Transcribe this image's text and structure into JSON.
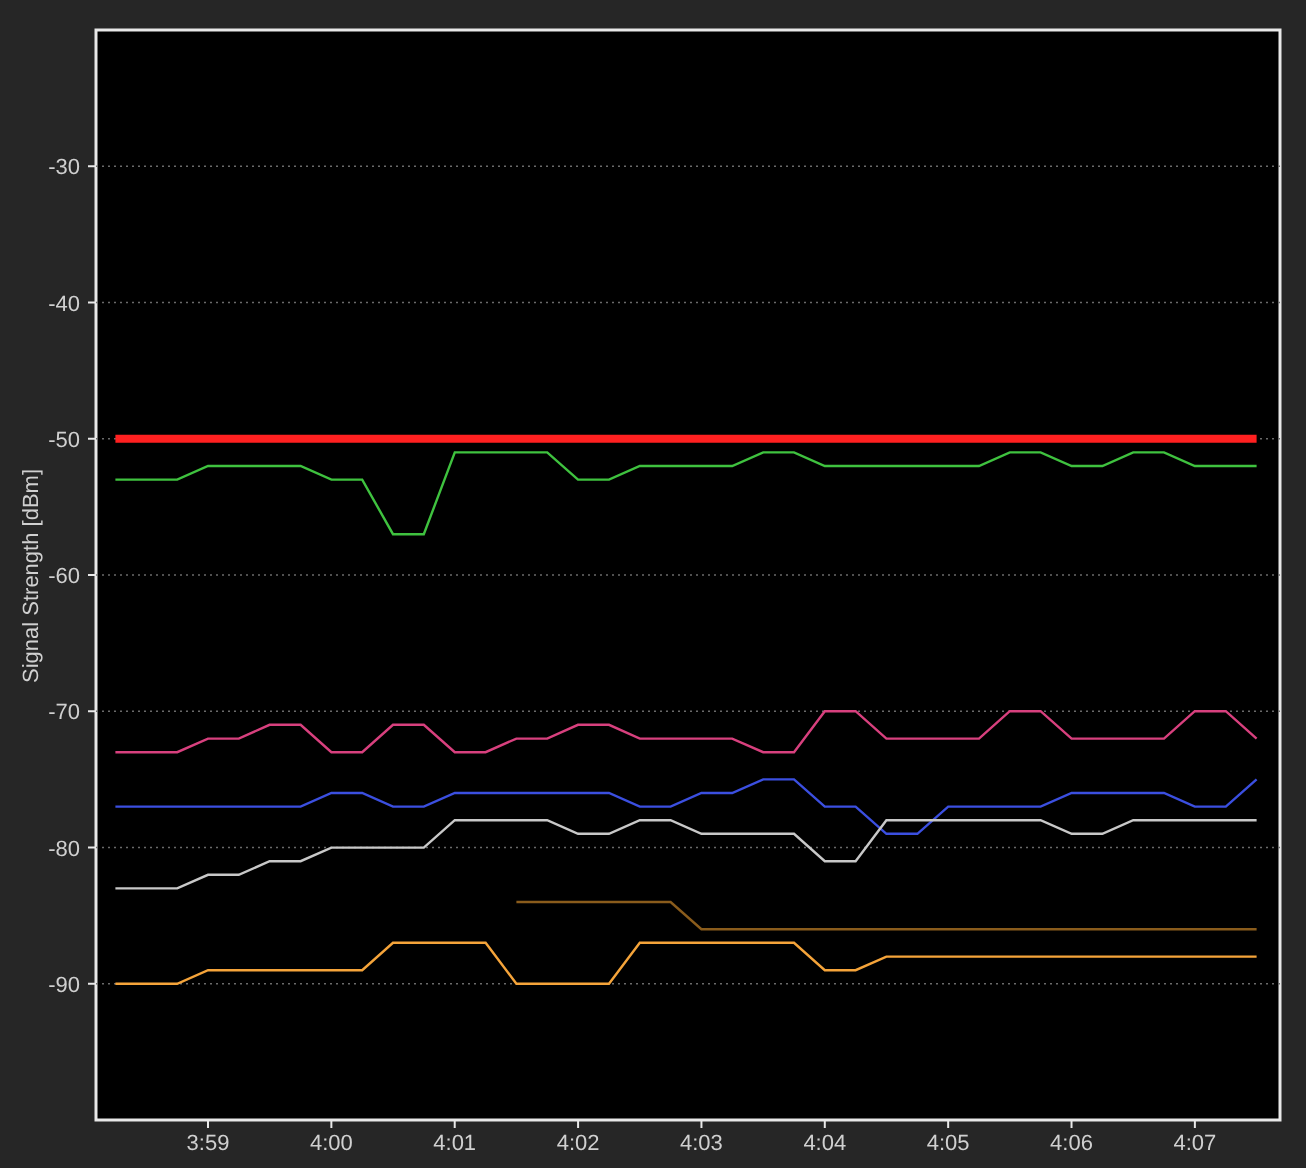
{
  "chart_data": {
    "type": "line",
    "ylabel": "Signal Strength [dBm]",
    "categories": [
      null,
      null,
      null,
      "3:59",
      null,
      null,
      null,
      "4:00",
      null,
      null,
      null,
      "4:01",
      null,
      null,
      null,
      "4:02",
      null,
      null,
      null,
      "4:03",
      null,
      null,
      null,
      "4:04",
      null,
      null,
      null,
      "4:05",
      null,
      null,
      null,
      "4:06",
      null,
      null,
      null,
      "4:07",
      null,
      null
    ],
    "ylim": [
      -100,
      -20
    ],
    "grid": true,
    "yticks": [
      -30,
      -40,
      -50,
      -60,
      -70,
      -80,
      -90
    ],
    "series": [
      {
        "color": "#3fc23f",
        "values": [
          -53,
          -53,
          -53,
          -52,
          -52,
          -52,
          -52,
          -53,
          -53,
          -57,
          -57,
          -51,
          -51,
          -51,
          -51,
          -53,
          -53,
          -52,
          -52,
          -52,
          -52,
          -51,
          -51,
          -52,
          -52,
          -52,
          -52,
          -52,
          -52,
          -51,
          -51,
          -52,
          -52,
          -51,
          -51,
          -52,
          -52,
          -52
        ]
      },
      {
        "color": "#d8407e",
        "values": [
          -73,
          -73,
          -73,
          -72,
          -72,
          -71,
          -71,
          -73,
          -73,
          -71,
          -71,
          -73,
          -73,
          -72,
          -72,
          -71,
          -71,
          -72,
          -72,
          -72,
          -72,
          -73,
          -73,
          -70,
          -70,
          -72,
          -72,
          -72,
          -72,
          -70,
          -70,
          -72,
          -72,
          -72,
          -72,
          -70,
          -70,
          -72
        ]
      },
      {
        "color": "#3b4fe0",
        "values": [
          -77,
          -77,
          -77,
          -77,
          -77,
          -77,
          -77,
          -76,
          -76,
          -77,
          -77,
          -76,
          -76,
          -76,
          -76,
          -76,
          -76,
          -77,
          -77,
          -76,
          -76,
          -75,
          -75,
          -77,
          -77,
          -79,
          -79,
          -77,
          -77,
          -77,
          -77,
          -76,
          -76,
          -76,
          -76,
          -77,
          -77,
          -75
        ]
      },
      {
        "color": "#c8c8c8",
        "values": [
          -83,
          -83,
          -83,
          -82,
          -82,
          -81,
          -81,
          -80,
          -80,
          -80,
          -80,
          -78,
          -78,
          -78,
          -78,
          -79,
          -79,
          -78,
          -78,
          -79,
          -79,
          -79,
          -79,
          -81,
          -81,
          -78,
          -78,
          -78,
          -78,
          -78,
          -78,
          -79,
          -79,
          -78,
          -78,
          -78,
          -78,
          -78
        ]
      },
      {
        "color": "#8a5c1c",
        "values": [
          null,
          null,
          null,
          null,
          null,
          null,
          null,
          null,
          null,
          null,
          null,
          null,
          null,
          -84,
          -84,
          -84,
          -84,
          -84,
          -84,
          -86,
          -86,
          -86,
          -86,
          -86,
          -86,
          -86,
          -86,
          -86,
          -86,
          -86,
          -86,
          -86,
          -86,
          -86,
          -86,
          -86,
          -86,
          -86
        ]
      },
      {
        "color": "#f5a43a",
        "values": [
          -90,
          -90,
          -90,
          -89,
          -89,
          -89,
          -89,
          -89,
          -89,
          -87,
          -87,
          -87,
          -87,
          -90,
          -90,
          -90,
          -90,
          -87,
          -87,
          -87,
          -87,
          -87,
          -87,
          -89,
          -89,
          -88,
          -88,
          -88,
          -88,
          -88,
          -88,
          -88,
          -88,
          -88,
          -88,
          -88,
          -88,
          -88
        ]
      },
      {
        "color": "#ff2020",
        "values": [
          -50,
          -50,
          -50,
          -50,
          -50,
          -50,
          -50,
          -50,
          -50,
          -50,
          -50,
          -50,
          -50,
          -50,
          -50,
          -50,
          -50,
          -50,
          -50,
          -50,
          -50,
          -50,
          -50,
          -50,
          -50,
          -50,
          -50,
          -50,
          -50,
          -50,
          -50,
          -50,
          -50,
          -50,
          -50,
          -50,
          -50,
          -50
        ]
      }
    ]
  }
}
